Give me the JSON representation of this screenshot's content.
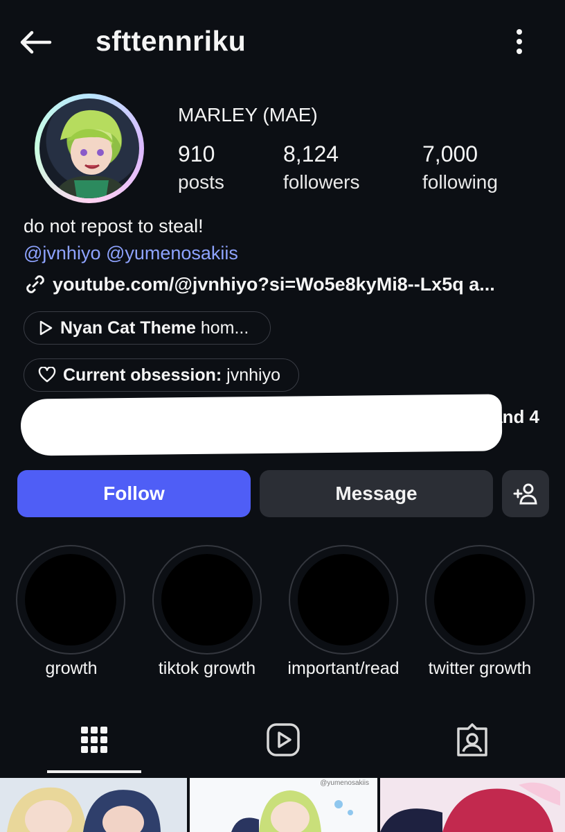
{
  "header": {
    "username": "sfttennriku",
    "back_icon": "arrow-left-icon",
    "more_icon": "kebab-menu-icon"
  },
  "profile": {
    "display_name": "MARLEY (MAE)",
    "stats": [
      {
        "value": "910",
        "label": "posts"
      },
      {
        "value": "8,124",
        "label": "followers"
      },
      {
        "value": "7,000",
        "label": "following"
      }
    ],
    "bio": "do not repost to steal!",
    "mentions": "@jvnhiyo @yumenosakiis",
    "link": "youtube.com/@jvnhiyo?si=Wo5e8kyMi8--Lx5q a...",
    "music_chip": {
      "title": "Nyan Cat Theme",
      "artist": "hom..."
    },
    "interest_chip": {
      "label": "Current obsession:",
      "value": "jvnhiyo"
    },
    "followed_by_tail": "n and 4"
  },
  "actions": {
    "follow": "Follow",
    "message": "Message",
    "accent": "#4f5ef6"
  },
  "highlights": [
    {
      "label": "growth"
    },
    {
      "label": "tiktok growth"
    },
    {
      "label": "important/read"
    },
    {
      "label": "twitter growth"
    }
  ],
  "tabs": [
    {
      "icon": "grid-icon",
      "active": true
    },
    {
      "icon": "reels-icon",
      "active": false
    },
    {
      "icon": "tagged-icon",
      "active": false
    }
  ],
  "thumbnails": [
    {
      "caption": ""
    },
    {
      "caption": "@yumenosakiis"
    },
    {
      "caption": ""
    }
  ]
}
